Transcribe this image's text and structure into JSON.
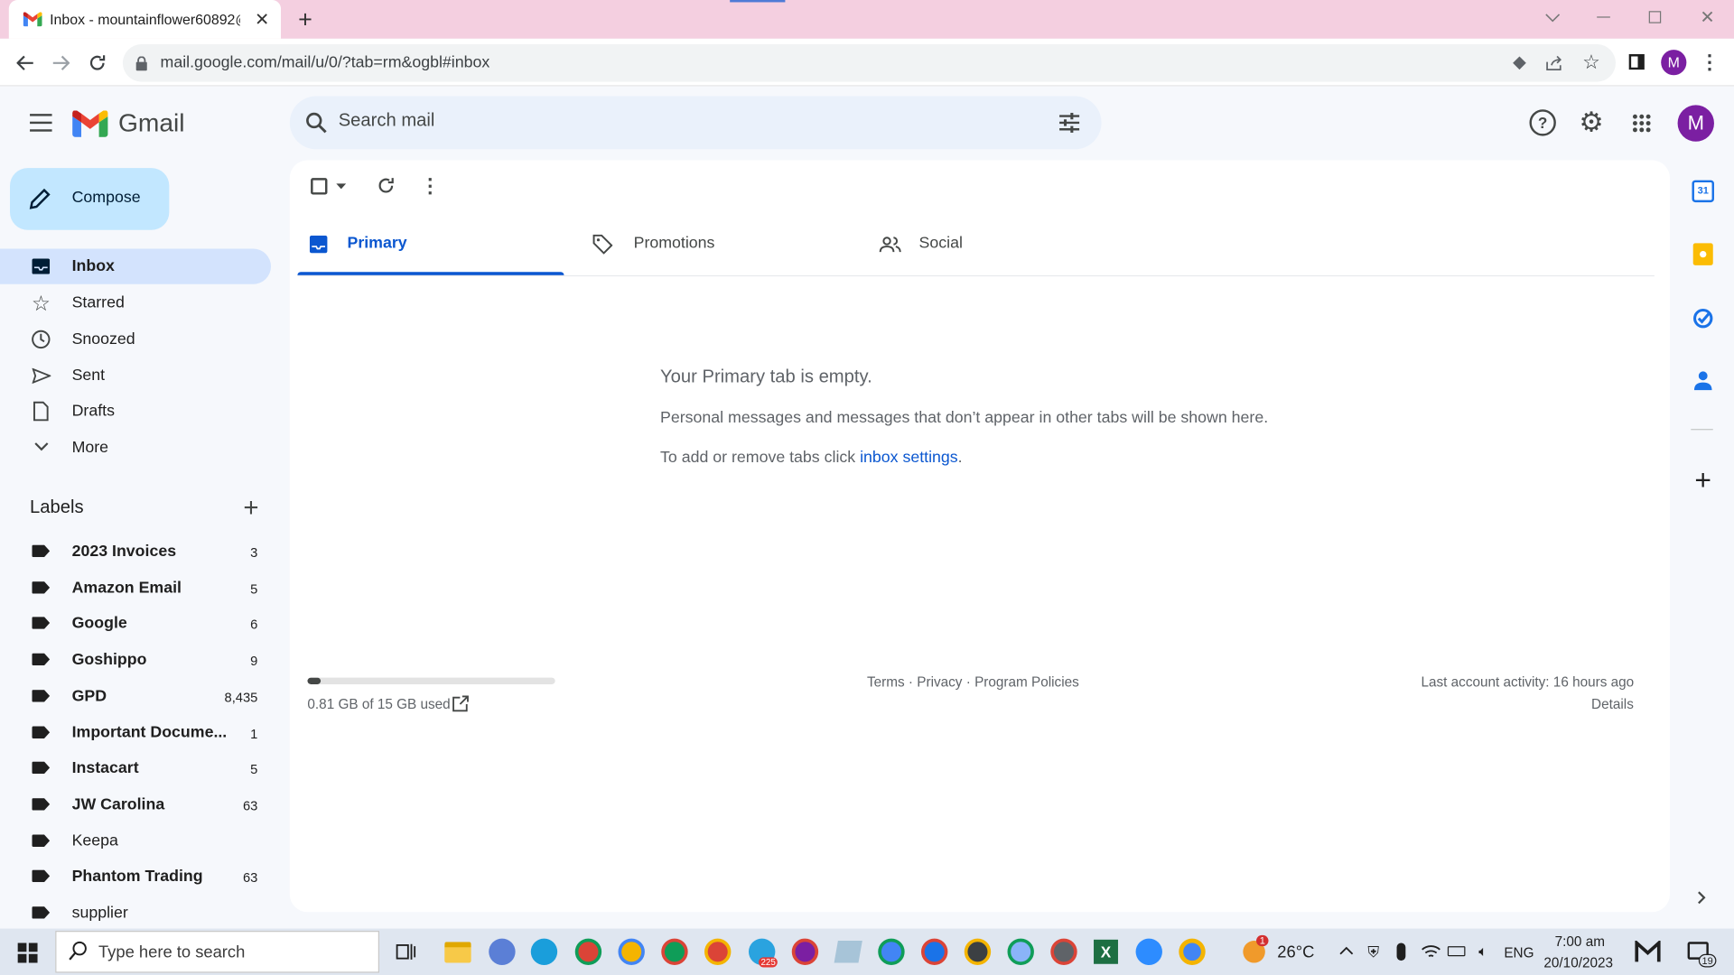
{
  "browser": {
    "tab_title": "Inbox - mountainflower60892@",
    "url": "mail.google.com/mail/u/0/?tab=rm&ogbl#inbox",
    "profile_initial": "M"
  },
  "gmail": {
    "brand": "Gmail",
    "search_placeholder": "Search mail",
    "avatar_initial": "M",
    "compose_label": "Compose",
    "nav": [
      {
        "label": "Inbox",
        "icon": "inbox-icon",
        "active": true
      },
      {
        "label": "Starred",
        "icon": "star-icon"
      },
      {
        "label": "Snoozed",
        "icon": "clock-icon"
      },
      {
        "label": "Sent",
        "icon": "send-icon"
      },
      {
        "label": "Drafts",
        "icon": "draft-icon"
      },
      {
        "label": "More",
        "icon": "chevron-down-icon"
      }
    ],
    "labels_heading": "Labels",
    "labels": [
      {
        "name": "2023 Invoices",
        "count": "3",
        "bold": true
      },
      {
        "name": "Amazon Email",
        "count": "5",
        "bold": true
      },
      {
        "name": "Google",
        "count": "6",
        "bold": true
      },
      {
        "name": "Goshippo",
        "count": "9",
        "bold": true
      },
      {
        "name": "GPD",
        "count": "8,435",
        "bold": true
      },
      {
        "name": "Important Docume...",
        "count": "1",
        "bold": true
      },
      {
        "name": "Instacart",
        "count": "5",
        "bold": true
      },
      {
        "name": "JW Carolina",
        "count": "63",
        "bold": true
      },
      {
        "name": "Keepa",
        "count": "",
        "bold": false
      },
      {
        "name": "Phantom Trading",
        "count": "63",
        "bold": true
      },
      {
        "name": "supplier",
        "count": "",
        "bold": false
      }
    ],
    "tabs": [
      {
        "label": "Primary",
        "active": true
      },
      {
        "label": "Promotions"
      },
      {
        "label": "Social"
      }
    ],
    "empty": {
      "title": "Your Primary tab is empty.",
      "line1": "Personal messages and messages that don’t appear in other tabs will be shown here.",
      "line2_prefix": "To add or remove tabs click ",
      "line2_link": "inbox settings",
      "line2_suffix": "."
    },
    "footer": {
      "storage": "0.81 GB of 15 GB used",
      "storage_fraction": 0.054,
      "terms": "Terms",
      "sep1": " · ",
      "privacy": "Privacy",
      "sep2": " · ",
      "policies": "Program Policies",
      "last_activity": "Last account activity: 16 hours ago",
      "details": "Details"
    }
  },
  "taskbar": {
    "search_placeholder": "Type here to search",
    "weather": "26°C",
    "weather_badge": "1",
    "language": "ENG",
    "time": "7:00 am",
    "date": "20/10/2023",
    "notifications": "19",
    "telegram_badge": "225"
  },
  "colors": {
    "accent": "#0b57d0",
    "compose_bg": "#c2e7ff",
    "nav_active": "#d3e3fd",
    "tabstrip": "#f4cfe0",
    "avatar": "#7b1fa2"
  }
}
